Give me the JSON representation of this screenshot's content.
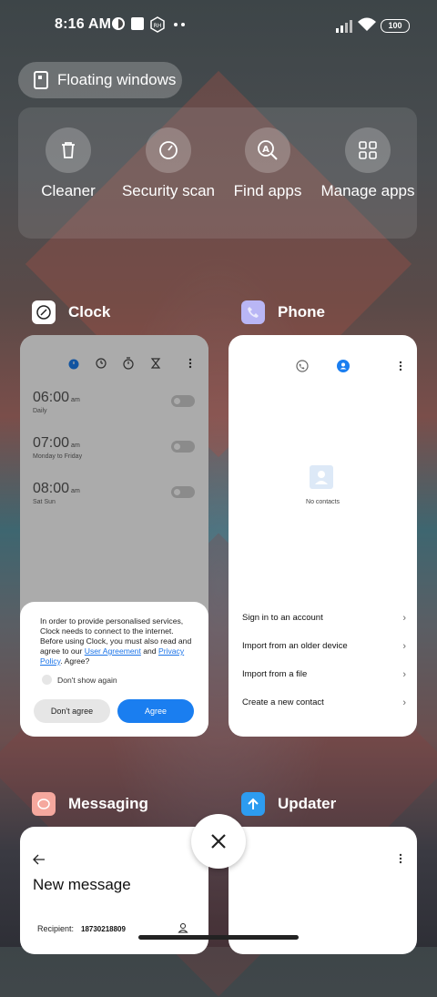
{
  "status_bar": {
    "time": "8:16 AM",
    "battery": "100"
  },
  "floating_windows": {
    "label": "Floating windows"
  },
  "quick_actions": [
    {
      "label": "Cleaner",
      "icon": "trash-icon"
    },
    {
      "label": "Security scan",
      "icon": "security-scan-icon"
    },
    {
      "label": "Find apps",
      "icon": "find-apps-icon"
    },
    {
      "label": "Manage apps",
      "icon": "manage-apps-icon"
    }
  ],
  "apps": {
    "clock": {
      "name": "Clock",
      "alarms": [
        {
          "time": "06:00",
          "ampm": "am",
          "repeat": "Daily"
        },
        {
          "time": "07:00",
          "ampm": "am",
          "repeat": "Monday to Friday"
        },
        {
          "time": "08:00",
          "ampm": "am",
          "repeat": "Sat Sun"
        }
      ],
      "dialog": {
        "text_before": "In order to provide personalised services, Clock needs to connect to the internet. Before using Clock, you must also read and agree to our ",
        "user_agreement": "User Agreement",
        "and": " and ",
        "privacy_policy": "Privacy Policy",
        "text_after": ". Agree?",
        "dont_show": "Don't show again",
        "dont_agree": "Don't agree",
        "agree": "Agree"
      }
    },
    "phone": {
      "name": "Phone",
      "empty_label": "No contacts",
      "options": [
        "Sign in to an account",
        "Import from an older device",
        "Import from a file",
        "Create a new contact"
      ]
    },
    "messaging": {
      "name": "Messaging",
      "title": "New message",
      "recipient_label": "Recipient:",
      "recipient_value": "18730218809"
    },
    "updater": {
      "name": "Updater"
    }
  },
  "colors": {
    "accent": "#1a7ef0",
    "clock_icon_bg": "#ffffff",
    "phone_icon_bg": "#b9b6f5",
    "messaging_icon_bg": "#f5a89e",
    "updater_icon_bg": "#2d9cf0"
  }
}
